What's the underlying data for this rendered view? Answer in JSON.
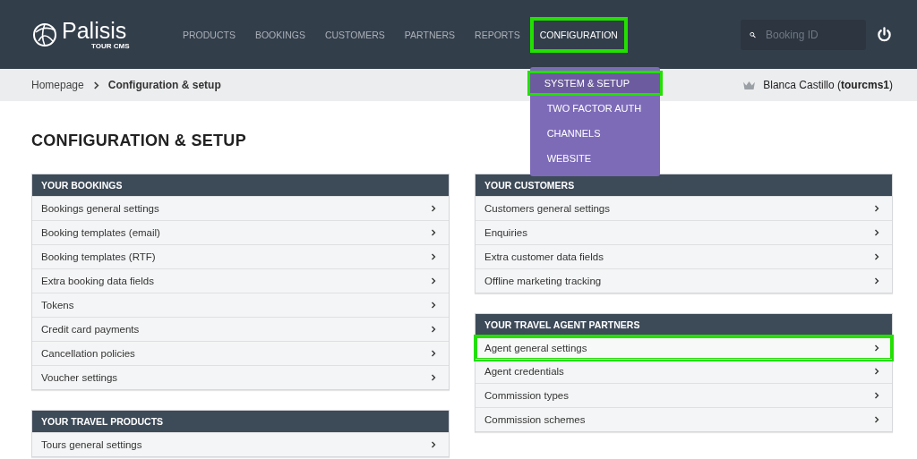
{
  "header": {
    "logo": {
      "name": "Palisis",
      "tagline": "TOUR CMS"
    },
    "nav": [
      {
        "label": "PRODUCTS",
        "selected": false,
        "highlighted": false
      },
      {
        "label": "BOOKINGS",
        "selected": false,
        "highlighted": false
      },
      {
        "label": "CUSTOMERS",
        "selected": false,
        "highlighted": false
      },
      {
        "label": "PARTNERS",
        "selected": false,
        "highlighted": false
      },
      {
        "label": "REPORTS",
        "selected": false,
        "highlighted": false
      },
      {
        "label": "CONFIGURATION",
        "selected": true,
        "highlighted": true
      }
    ],
    "dropdown": {
      "expanded": true,
      "items": [
        {
          "label": "SYSTEM & SETUP",
          "selected": true,
          "highlighted": true
        },
        {
          "label": "TWO FACTOR AUTH",
          "selected": false,
          "highlighted": false
        },
        {
          "label": "CHANNELS",
          "selected": false,
          "highlighted": false
        },
        {
          "label": "WEBSITE",
          "selected": false,
          "highlighted": false
        }
      ]
    },
    "search": {
      "placeholder": "Booking ID"
    }
  },
  "breadcrumb": [
    {
      "label": "Homepage",
      "current": false
    },
    {
      "label": "Configuration & setup",
      "current": true
    }
  ],
  "user": {
    "text": "Blanca Castillo (**tourcms1**)"
  },
  "page_title": "CONFIGURATION & SETUP",
  "left_panels": [
    {
      "title": "YOUR BOOKINGS",
      "items": [
        {
          "label": "Bookings general settings",
          "highlighted": false
        },
        {
          "label": "Booking templates (email)",
          "highlighted": false
        },
        {
          "label": "Booking templates (RTF)",
          "highlighted": false
        },
        {
          "label": "Extra booking data fields",
          "highlighted": false
        },
        {
          "label": "Tokens",
          "highlighted": false
        },
        {
          "label": "Credit card payments",
          "highlighted": false
        },
        {
          "label": "Cancellation policies",
          "highlighted": false
        },
        {
          "label": "Voucher settings",
          "highlighted": false
        }
      ]
    },
    {
      "title": "YOUR TRAVEL PRODUCTS",
      "items": [
        {
          "label": "Tours general settings",
          "highlighted": false
        }
      ]
    }
  ],
  "right_panels": [
    {
      "title": "YOUR CUSTOMERS",
      "items": [
        {
          "label": "Customers general settings",
          "highlighted": false
        },
        {
          "label": "Enquiries",
          "highlighted": false
        },
        {
          "label": "Extra customer data fields",
          "highlighted": false
        },
        {
          "label": "Offline marketing tracking",
          "highlighted": false
        }
      ]
    },
    {
      "title": "YOUR TRAVEL AGENT PARTNERS",
      "items": [
        {
          "label": "Agent general settings",
          "highlighted": true
        },
        {
          "label": "Agent credentials",
          "highlighted": false
        },
        {
          "label": "Commission types",
          "highlighted": false
        },
        {
          "label": "Commission schemes",
          "highlighted": false
        }
      ]
    }
  ]
}
